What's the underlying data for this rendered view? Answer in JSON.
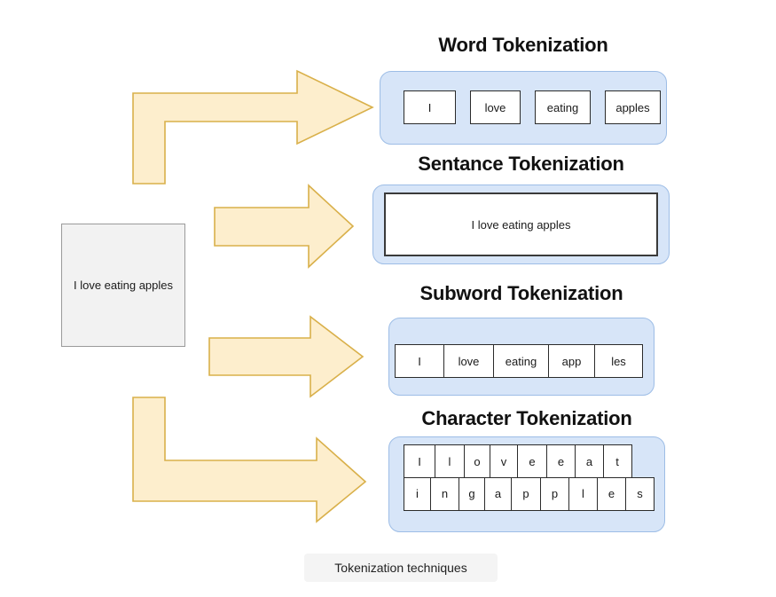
{
  "source": {
    "text": "I love eating apples"
  },
  "sections": [
    {
      "key": "word",
      "title": "Word Tokenization",
      "tokens": [
        "I",
        "love",
        "eating",
        "apples"
      ]
    },
    {
      "key": "sentence",
      "title": "Sentance Tokenization",
      "tokens": [
        "I love eating apples"
      ]
    },
    {
      "key": "subword",
      "title": "Subword Tokenization",
      "tokens": [
        "I",
        "love",
        "eating",
        "app",
        "les"
      ]
    },
    {
      "key": "character",
      "title": "Character Tokenization",
      "rows": [
        [
          "I",
          "l",
          "o",
          "v",
          "e",
          "e",
          "a",
          "t"
        ],
        [
          "i",
          "n",
          "g",
          "a",
          "p",
          "p",
          "l",
          "e",
          "s"
        ]
      ]
    }
  ],
  "caption": {
    "text": "Tokenization techniques"
  },
  "colors": {
    "arrow_fill": "#fdeecd",
    "arrow_stroke": "#d9b04a",
    "panel_fill": "#d7e5f8",
    "panel_stroke": "#9dbde6",
    "source_fill": "#f2f2f2",
    "source_stroke": "#9a9a9a",
    "token_stroke": "#2b2b2b",
    "caption_fill": "#f4f4f4",
    "title_color": "#111111"
  }
}
